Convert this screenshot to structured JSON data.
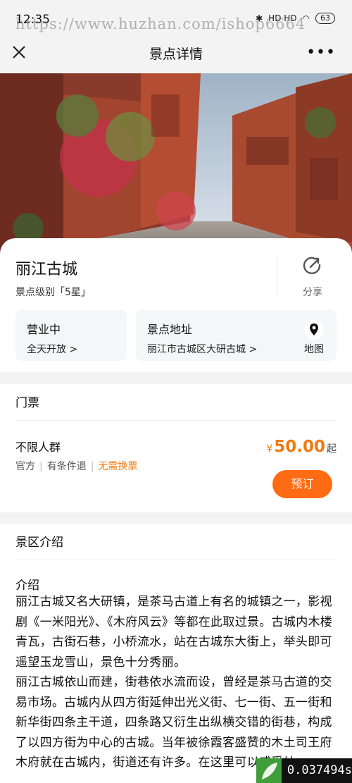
{
  "status": {
    "time": "12:35",
    "network": "HD HD",
    "battery": "63"
  },
  "watermark": "https://www.huzhan.com/ishop6664",
  "nav": {
    "title": "景点详情",
    "more": "•••"
  },
  "spot": {
    "name": "丽江古城",
    "level": "景点级别「5星」",
    "share_label": "分享",
    "open": {
      "title": "营业中",
      "hours": "全天开放 >"
    },
    "address": {
      "title": "景点地址",
      "value": "丽江市古城区大研古城 >",
      "map_label": "地图"
    }
  },
  "tickets": {
    "section_title": "门票",
    "item": {
      "name": "不限人群",
      "tags": [
        "官方",
        "有条件退",
        "无需换票"
      ],
      "currency": "¥",
      "price": "50.00",
      "suffix": "起",
      "book_label": "预订"
    }
  },
  "intro": {
    "section_title": "景区介绍",
    "subtitle": "介绍",
    "text": "丽江古城又名大研镇，是茶马古道上有名的城镇之一，影视剧《一米阳光》、《木府风云》等都在此取过景。古城内木楼青瓦，古街石巷，小桥流水，站在古城东大街上，举头即可遥望玉龙雪山，景色十分秀丽。\n丽江古城依山而建，街巷依水流而设，曾经是茶马古道的交易市场。古城内从四方街延伸出光义街、七一街、五一街和新华街四条主干道，四条路又衍生出纵横交错的街巷，构成了以四方街为中心的古城。当年被徐霞客盛赞的木土司王府木府就在古城内，街道还有许多。在这里可以感受纳"
  },
  "overlay": {
    "timer": "0.037494s"
  },
  "colors": {
    "accent": "#ff6b12",
    "price": "#f07a12"
  }
}
